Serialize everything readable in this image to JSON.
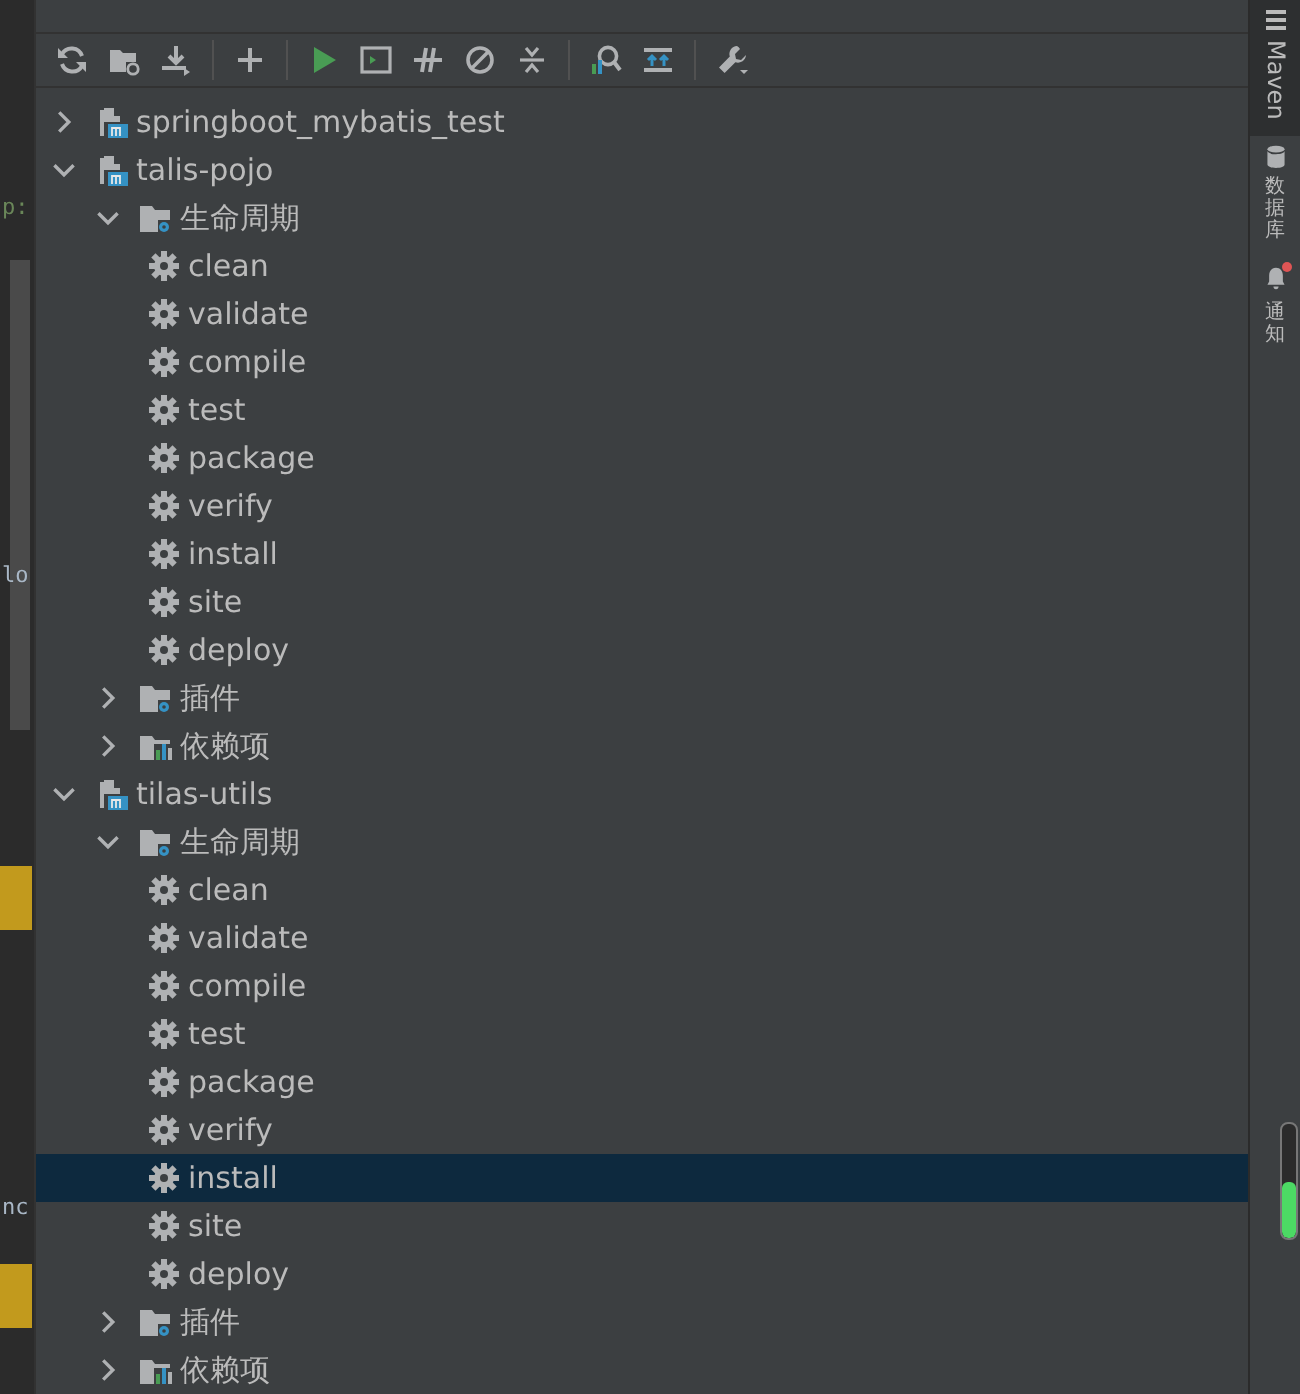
{
  "editor_fragments": [
    {
      "text": "p:",
      "kind": "code"
    },
    {
      "text": "lo",
      "kind": "plain"
    },
    {
      "text": "nc",
      "kind": "plain"
    }
  ],
  "toolbar": [
    {
      "kind": "reload"
    },
    {
      "kind": "add-folder"
    },
    {
      "kind": "download"
    },
    {
      "kind": "sep"
    },
    {
      "kind": "add"
    },
    {
      "kind": "sep"
    },
    {
      "kind": "run"
    },
    {
      "kind": "config"
    },
    {
      "kind": "offline"
    },
    {
      "kind": "skip"
    },
    {
      "kind": "collapse"
    },
    {
      "kind": "sep"
    },
    {
      "kind": "analyze"
    },
    {
      "kind": "deps"
    },
    {
      "kind": "sep"
    },
    {
      "kind": "settings"
    }
  ],
  "tree": [
    {
      "label": "springboot_mybatis_test",
      "kind": "module",
      "expanded": false,
      "selected": false
    },
    {
      "label": "talis-pojo",
      "kind": "module",
      "expanded": true,
      "selected": false,
      "children": [
        {
          "label": "生命周期",
          "kind": "lifecycle",
          "expanded": true,
          "selected": false,
          "children": [
            {
              "label": "clean",
              "kind": "goal",
              "selected": false
            },
            {
              "label": "validate",
              "kind": "goal",
              "selected": false
            },
            {
              "label": "compile",
              "kind": "goal",
              "selected": false
            },
            {
              "label": "test",
              "kind": "goal",
              "selected": false
            },
            {
              "label": "package",
              "kind": "goal",
              "selected": false
            },
            {
              "label": "verify",
              "kind": "goal",
              "selected": false
            },
            {
              "label": "install",
              "kind": "goal",
              "selected": false
            },
            {
              "label": "site",
              "kind": "goal",
              "selected": false
            },
            {
              "label": "deploy",
              "kind": "goal",
              "selected": false
            }
          ]
        },
        {
          "label": "插件",
          "kind": "plugins",
          "expanded": false,
          "selected": false
        },
        {
          "label": "依赖项",
          "kind": "dependencies",
          "expanded": false,
          "selected": false
        }
      ]
    },
    {
      "label": "tilas-utils",
      "kind": "module",
      "expanded": true,
      "selected": false,
      "children": [
        {
          "label": "生命周期",
          "kind": "lifecycle",
          "expanded": true,
          "selected": false,
          "children": [
            {
              "label": "clean",
              "kind": "goal",
              "selected": false
            },
            {
              "label": "validate",
              "kind": "goal",
              "selected": false
            },
            {
              "label": "compile",
              "kind": "goal",
              "selected": false
            },
            {
              "label": "test",
              "kind": "goal",
              "selected": false
            },
            {
              "label": "package",
              "kind": "goal",
              "selected": false
            },
            {
              "label": "verify",
              "kind": "goal",
              "selected": false
            },
            {
              "label": "install",
              "kind": "goal",
              "selected": true
            },
            {
              "label": "site",
              "kind": "goal",
              "selected": false
            },
            {
              "label": "deploy",
              "kind": "goal",
              "selected": false
            }
          ]
        },
        {
          "label": "插件",
          "kind": "plugins",
          "expanded": false,
          "selected": false
        },
        {
          "label": "依赖项",
          "kind": "dependencies",
          "expanded": false,
          "selected": false
        }
      ]
    }
  ],
  "side_tabs": [
    {
      "label": "Maven",
      "kind": "maven",
      "selected": true
    },
    {
      "label": "数据库",
      "kind": "database",
      "selected": false
    },
    {
      "label": "通知",
      "kind": "notifications",
      "selected": false,
      "badge": true
    }
  ],
  "memory": {
    "level": 0.5
  }
}
